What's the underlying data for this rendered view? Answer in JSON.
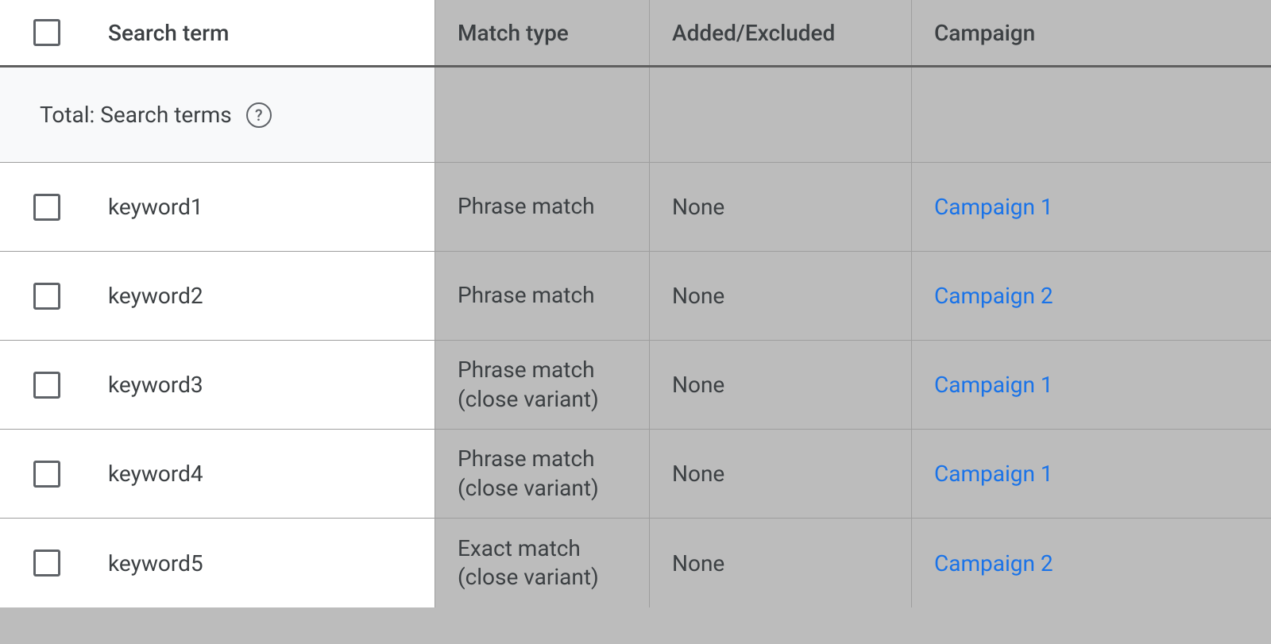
{
  "table": {
    "headers": {
      "search_term": "Search term",
      "match_type": "Match type",
      "added_excluded": "Added/Excluded",
      "campaign": "Campaign"
    },
    "total_label": "Total: Search terms",
    "rows": [
      {
        "term": "keyword1",
        "match": "Phrase match",
        "added": "None",
        "campaign": "Campaign 1"
      },
      {
        "term": "keyword2",
        "match": "Phrase match",
        "added": "None",
        "campaign": "Campaign 2"
      },
      {
        "term": "keyword3",
        "match": "Phrase match (close variant)",
        "added": "None",
        "campaign": "Campaign 1"
      },
      {
        "term": "keyword4",
        "match": "Phrase match (close variant)",
        "added": "None",
        "campaign": "Campaign 1"
      },
      {
        "term": "keyword5",
        "match": "Exact match (close variant)",
        "added": "None",
        "campaign": "Campaign 2"
      }
    ]
  }
}
